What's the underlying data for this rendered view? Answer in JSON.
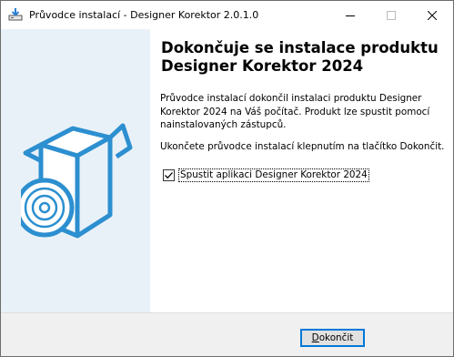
{
  "window": {
    "title": "Průvodce instalací - Designer Korektor 2.0.1.0"
  },
  "main": {
    "heading": "Dokončuje se instalace produktu Designer Korektor 2024",
    "paragraph1": "Průvodce instalací dokončil instalaci produktu Designer Korektor 2024 na Váš počítač. Produkt lze spustit pomocí nainstalovaných zástupců.",
    "paragraph2": "Ukončete průvodce instalací klepnutím na tlačítko Dokončit.",
    "launch_checkbox": {
      "label": "Spustit aplikaci Designer Korektor 2024",
      "checked": true
    }
  },
  "footer": {
    "finish_button": {
      "accesskey": "D",
      "label_rest": "okončit"
    }
  },
  "icons": {
    "app": "installer-icon",
    "illustration": "box-with-disc-icon"
  },
  "colors": {
    "accent": "#0078d7",
    "side_panel": "#e9f1f8",
    "box_blue": "#2c8fd0"
  }
}
